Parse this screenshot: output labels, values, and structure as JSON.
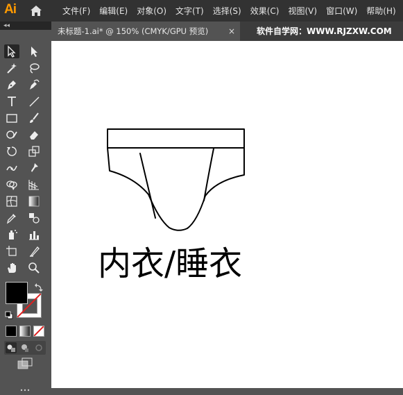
{
  "app": {
    "logo_text": "Ai"
  },
  "menu": [
    "文件(F)",
    "编辑(E)",
    "对象(O)",
    "文字(T)",
    "选择(S)",
    "效果(C)",
    "视图(V)",
    "窗口(W)",
    "帮助(H)"
  ],
  "document_tab": {
    "title": "未标题-1.ai* @ 150% (CMYK/GPU 预览)",
    "close_label": "×"
  },
  "watermark": "软件自学网：WWW.RJZXW.COM",
  "panel": {
    "collapse_label": "◂◂"
  },
  "canvas": {
    "text": "内衣/睡衣"
  },
  "colors": {
    "fill": "#000000",
    "stroke": "#ffffff",
    "accent": "#ff9a00",
    "menubar": "#323232",
    "toolbar": "#535353"
  },
  "tools": [
    "selection-tool",
    "direct-selection-tool",
    "magic-wand-tool",
    "lasso-tool",
    "pen-tool",
    "curvature-tool",
    "type-tool",
    "line-segment-tool",
    "rectangle-tool",
    "paintbrush-tool",
    "shaper-tool",
    "eraser-tool",
    "rotate-tool",
    "scale-tool",
    "width-tool",
    "puppet-warp-tool",
    "shape-builder-tool",
    "perspective-grid-tool",
    "mesh-tool",
    "gradient-tool",
    "eyedropper-tool",
    "blend-tool",
    "symbol-sprayer-tool",
    "column-graph-tool",
    "artboard-tool",
    "slice-tool",
    "hand-tool",
    "zoom-tool"
  ]
}
